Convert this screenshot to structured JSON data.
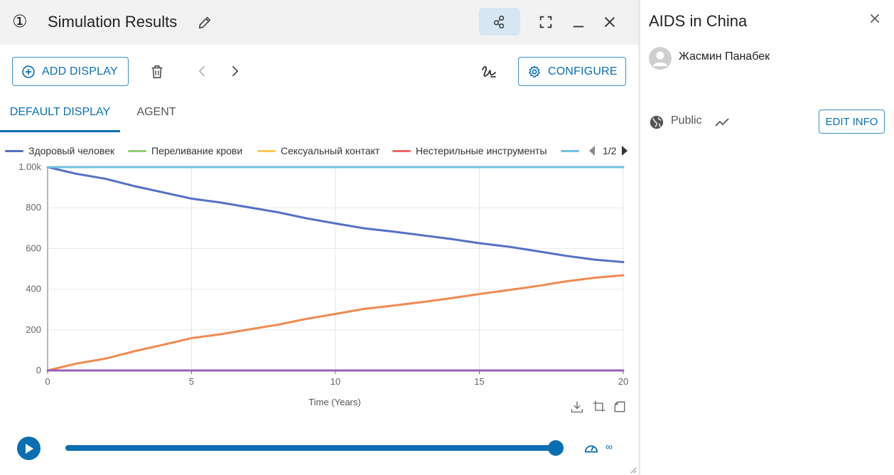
{
  "window": {
    "number": "①",
    "title": "Simulation Results"
  },
  "toolbar": {
    "add_display_label": "ADD DISPLAY",
    "configure_label": "CONFIGURE"
  },
  "tabs": [
    {
      "label": "DEFAULT DISPLAY",
      "active": true
    },
    {
      "label": "AGENT",
      "active": false
    }
  ],
  "legend": {
    "items": [
      {
        "name": "Здоровый человек",
        "color": "#5470c6"
      },
      {
        "name": "Переливание крови",
        "color": "#91cc75"
      },
      {
        "name": "Сексуальный контакт",
        "color": "#fac858"
      },
      {
        "name": "Нестерильные инструменты",
        "color": "#ee6666"
      },
      {
        "name": "",
        "color": "#73c0de"
      }
    ],
    "page": "1/2"
  },
  "chart_data": {
    "type": "line",
    "xlabel": "Time (Years)",
    "ylabel": "",
    "xlim": [
      0,
      20
    ],
    "ylim": [
      0,
      1000
    ],
    "x_ticks": [
      "0",
      "5",
      "10",
      "15",
      "20"
    ],
    "y_ticks": [
      "0",
      "200",
      "400",
      "600",
      "800",
      "1.00k"
    ],
    "grid": true,
    "x": [
      0,
      1,
      2,
      3,
      4,
      5,
      6,
      7,
      8,
      9,
      10,
      11,
      12,
      13,
      14,
      15,
      16,
      17,
      18,
      19,
      20
    ],
    "series": [
      {
        "name": "Здоровый человек",
        "color": "#5470c6",
        "values": [
          1000,
          967,
          943,
          907,
          876,
          845,
          826,
          802,
          778,
          748,
          723,
          699,
          683,
          665,
          647,
          626,
          609,
          587,
          564,
          545,
          533
        ]
      },
      {
        "name": "",
        "color": "#f08a51",
        "values": [
          0,
          34,
          58,
          94,
          126,
          159,
          178,
          202,
          225,
          254,
          278,
          303,
          319,
          336,
          355,
          376,
          395,
          415,
          438,
          456,
          468
        ]
      },
      {
        "name": "",
        "color": "#73c0de",
        "values": [
          1000,
          1000,
          1000,
          1000,
          1000,
          1000,
          1000,
          1000,
          1000,
          1000,
          1000,
          1000,
          1000,
          1000,
          1000,
          1000,
          1000,
          1000,
          1000,
          1000,
          1000
        ]
      },
      {
        "name": "",
        "color": "#9a60b4",
        "values": [
          0,
          0,
          0,
          0,
          0,
          0,
          0,
          0,
          0,
          0,
          0,
          0,
          0,
          0,
          0,
          0,
          0,
          0,
          0,
          0,
          0
        ]
      }
    ]
  },
  "player": {
    "progress": 1.0,
    "speed": "∞"
  },
  "side_panel": {
    "title": "AIDS in China",
    "author": "Жасмин Панабек",
    "visibility": "Public",
    "edit_label": "EDIT INFO"
  },
  "colors": {
    "accent": "#0b6eb3",
    "titlebar_bg": "#f2f2f2",
    "active_button_bg": "#d6e6f2"
  }
}
